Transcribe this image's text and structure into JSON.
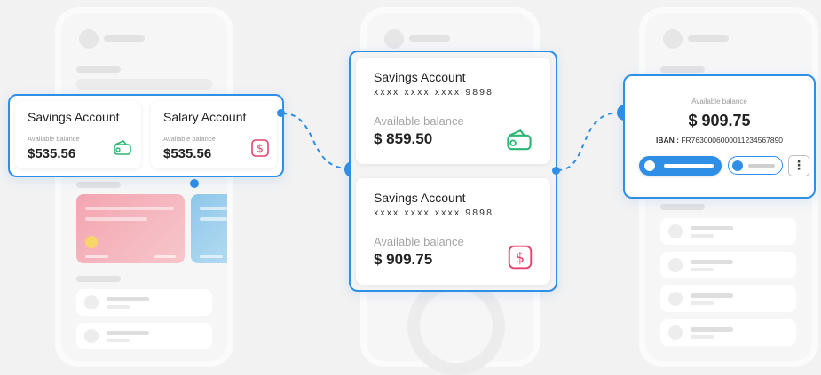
{
  "colors": {
    "accent": "#2f8fe6",
    "wallet_green": "#2bb673",
    "dollar_red": "#e8416c"
  },
  "left_panel": {
    "cards": [
      {
        "title": "Savings Account",
        "available_label": "Available balance",
        "balance": "$535.56",
        "icon": "wallet-icon"
      },
      {
        "title": "Salary Account",
        "available_label": "Available balance",
        "balance": "$535.56",
        "icon": "dollar-icon"
      }
    ]
  },
  "middle_panel": {
    "cards": [
      {
        "title": "Savings Account",
        "masked_number": "xxxx xxxx xxxx 9898",
        "available_label": "Available balance",
        "balance": "$ 859.50",
        "icon": "wallet-icon"
      },
      {
        "title": "Savings Account",
        "masked_number": "xxxx xxxx xxxx 9898",
        "available_label": "Available balance",
        "balance": "$ 909.75",
        "icon": "dollar-icon"
      }
    ]
  },
  "right_panel": {
    "available_label": "Available balance",
    "balance": "$ 909.75",
    "iban_label": "IBAN :",
    "iban_value": "FR7630006000011234567890",
    "more_icon": "more-vertical-icon"
  },
  "connectors": {
    "arrow_icon": "chevron-right-icon"
  }
}
